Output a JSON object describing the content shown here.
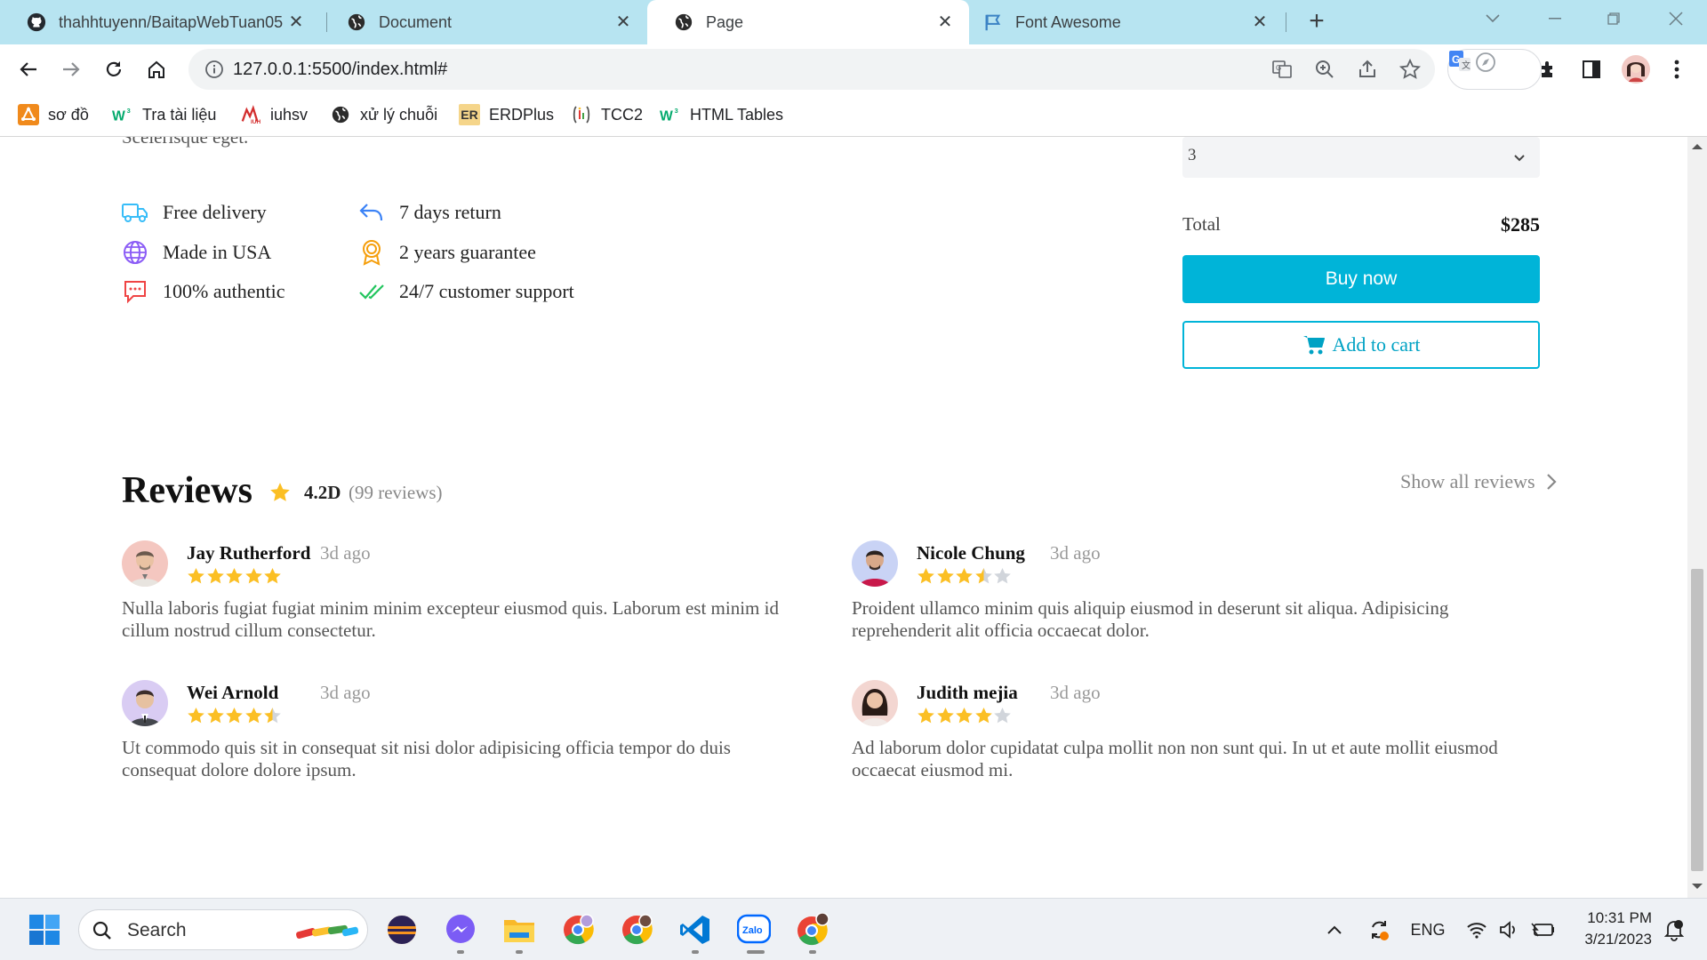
{
  "browser": {
    "tabs": [
      {
        "title": "thahhtuyenn/BaitapWebTuan05",
        "icon": "github-icon",
        "active": false
      },
      {
        "title": "Document",
        "icon": "globe-icon",
        "active": false
      },
      {
        "title": "Page",
        "icon": "globe-icon",
        "active": true
      },
      {
        "title": "Font Awesome",
        "icon": "flag-icon",
        "active": false
      }
    ],
    "url": "127.0.0.1:5500/index.html#",
    "bookmarks": [
      {
        "label": "sơ đồ",
        "icon": "diagram-icon"
      },
      {
        "label": "Tra tài liệu",
        "icon": "w3-icon"
      },
      {
        "label": "iuhsv",
        "icon": "iuh-icon"
      },
      {
        "label": "xử lý chuỗi",
        "icon": "globe-icon"
      },
      {
        "label": "ERDPlus",
        "icon": "er-icon",
        "icon_text": "ER"
      },
      {
        "label": "TCC2",
        "icon": "tcc-icon"
      },
      {
        "label": "HTML Tables",
        "icon": "w3-icon"
      }
    ]
  },
  "page": {
    "cut_text": "Scelerisque eget.",
    "features": [
      {
        "label": "Free delivery",
        "icon": "truck-icon"
      },
      {
        "label": "7 days return",
        "icon": "return-arrow-icon"
      },
      {
        "label": "Made in USA",
        "icon": "globe-icon"
      },
      {
        "label": "2 years guarantee",
        "icon": "award-icon"
      },
      {
        "label": "100% authentic",
        "icon": "message-icon"
      },
      {
        "label": "24/7 customer support",
        "icon": "double-check-icon"
      }
    ],
    "quantity": {
      "value": "3"
    },
    "total": {
      "label": "Total",
      "value": "$285"
    },
    "buy_label": "Buy now",
    "cart_label": "Add to cart",
    "reviews": {
      "title": "Reviews",
      "rating": "4.2D",
      "count": "(99 reviews)",
      "show_all": "Show all reviews",
      "items": [
        {
          "name": "Jay Rutherford",
          "time": "3d ago",
          "rating": 5,
          "text": "Nulla laboris fugiat fugiat minim minim excepteur eiusmod quis. Laborum est minim id cillum nostrud cillum consectetur."
        },
        {
          "name": "Nicole Chung",
          "time": "3d ago",
          "rating": 3.5,
          "text": "Proident ullamco minim quis aliquip eiusmod in deserunt sit aliqua. Adipisicing reprehenderit alit officia occaecat dolor."
        },
        {
          "name": "Wei Arnold",
          "time": "3d ago",
          "rating": 4.5,
          "text": "Ut commodo quis sit in consequat sit nisi dolor adipisicing officia tempor do duis consequat dolore dolore ipsum."
        },
        {
          "name": "Judith mejia",
          "time": "3d ago",
          "rating": 4,
          "text": "Ad laborum dolor cupidatat culpa mollit non non sunt qui. In ut et aute mollit eiusmod occaecat eiusmod mi."
        }
      ]
    }
  },
  "taskbar": {
    "search_label": "Search",
    "language": "ENG",
    "time": "10:31 PM",
    "date": "3/21/2023"
  },
  "colors": {
    "tab_strip": "#b7e4f1",
    "accent": "#00b4d8",
    "star": "#fbbf24",
    "star_empty": "#d1d5db"
  }
}
